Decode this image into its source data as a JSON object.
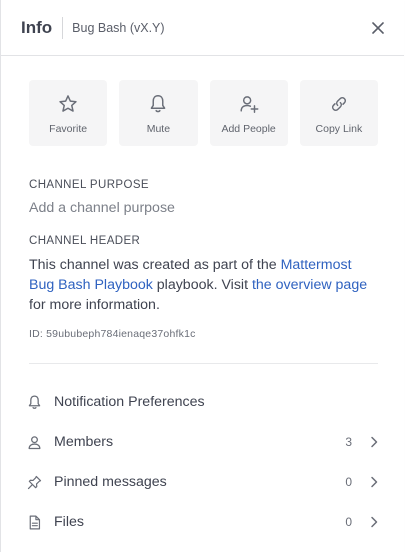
{
  "header": {
    "title": "Info",
    "channel_name": "Bug Bash (vX.Y)"
  },
  "actions": [
    {
      "label": "Favorite",
      "icon": "star-icon"
    },
    {
      "label": "Mute",
      "icon": "bell-icon"
    },
    {
      "label": "Add People",
      "icon": "add-user-icon"
    },
    {
      "label": "Copy Link",
      "icon": "link-icon"
    }
  ],
  "purpose": {
    "title": "CHANNEL PURPOSE",
    "placeholder": "Add a channel purpose"
  },
  "channel_header": {
    "title": "CHANNEL HEADER",
    "text_1": "This channel was created as part of the ",
    "link_1": "Mattermost Bug Bash Playbook",
    "text_2": " playbook. Visit ",
    "link_2": "the overview page",
    "text_3": " for more information."
  },
  "channel_id": "ID: 59ububeph784ienaqe37ohfk1c",
  "menu": [
    {
      "label": "Notification Preferences",
      "count": "",
      "icon": "bell-icon"
    },
    {
      "label": "Members",
      "count": "3",
      "icon": "account-icon"
    },
    {
      "label": "Pinned messages",
      "count": "0",
      "icon": "pin-icon"
    },
    {
      "label": "Files",
      "count": "0",
      "icon": "file-icon"
    }
  ],
  "colors": {
    "link": "#2f62c0",
    "text": "#3f4350",
    "action_bg": "#f5f5f6"
  }
}
